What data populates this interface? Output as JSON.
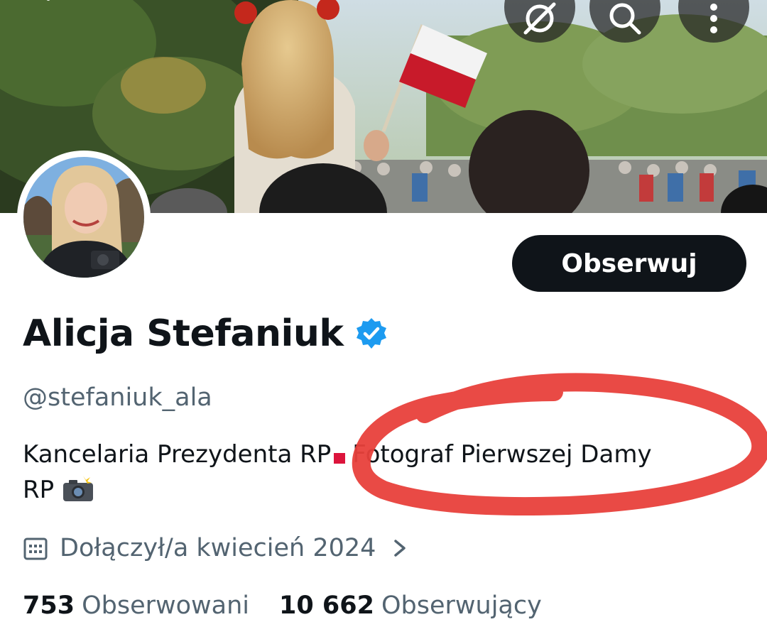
{
  "profile": {
    "display_name": "Alicja Stefaniuk",
    "handle": "@stefaniuk_ala",
    "verified": true,
    "bio_line1_text": "Kancelaria Prezydenta RP",
    "bio_line1_flag": "flag-poland-emoji",
    "bio_line1_rest": "Fotograf Pierwszej Damy",
    "bio_line2_text": "RP",
    "bio_line2_emoji": "camera-with-flash-emoji",
    "joined": "Dołączył/a kwiecień 2024",
    "stats": {
      "following_count": "753",
      "following_label": "Obserwowani",
      "followers_count": "10 662",
      "followers_label": "Obserwujący"
    }
  },
  "actions": {
    "follow_label": "Obserwuj"
  },
  "toolbar": {
    "icons": [
      "back-arrow-icon",
      "grok-icon",
      "search-icon",
      "more-vert-icon"
    ]
  },
  "colors": {
    "primary_text": "#0f1419",
    "secondary_text": "#536471",
    "verified_blue": "#1d9bf0",
    "annotation_red": "#e8403b"
  }
}
